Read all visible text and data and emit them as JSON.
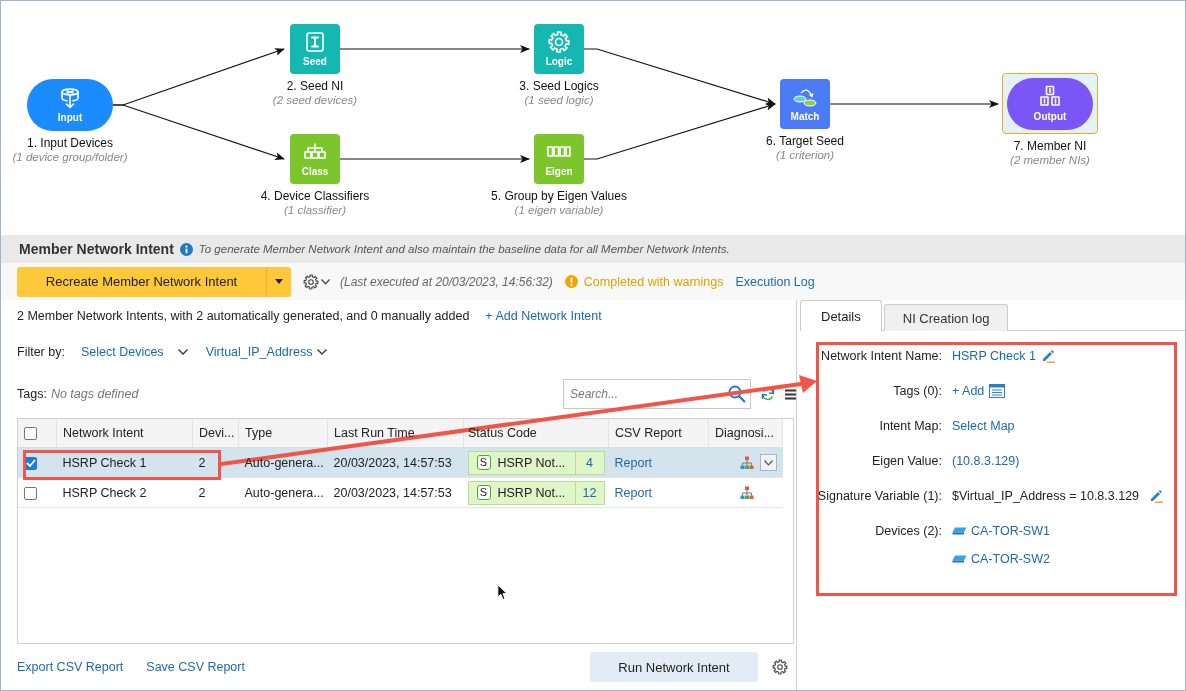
{
  "diagram": {
    "nodes": [
      {
        "kind": "input",
        "tile_label": "Input",
        "title": "1. Input Devices",
        "subtitle": "(1 device group/folder)",
        "color": "#1a8cff",
        "selected": false
      },
      {
        "kind": "seed",
        "tile_label": "Seed",
        "title": "2. Seed NI",
        "subtitle": "(2 seed devices)",
        "color": "#14b8b1",
        "selected": false
      },
      {
        "kind": "logic",
        "tile_label": "Logic",
        "title": "3. Seed Logics",
        "subtitle": "(1 seed logic)",
        "color": "#14b8b1",
        "selected": false
      },
      {
        "kind": "class",
        "tile_label": "Class",
        "title": "4. Device Classifiers",
        "subtitle": "(1 classifier)",
        "color": "#7cc52c",
        "selected": false
      },
      {
        "kind": "eigen",
        "tile_label": "Eigen",
        "title": "5. Group by Eigen Values",
        "subtitle": "(1 eigen variable)",
        "color": "#7cc52c",
        "selected": false
      },
      {
        "kind": "match",
        "tile_label": "Match",
        "title": "6. Target Seed",
        "subtitle": "(1 criterion)",
        "color": "#4b7bf7",
        "selected": false
      },
      {
        "kind": "output",
        "tile_label": "Output",
        "title": "7. Member NI",
        "subtitle": "(2 member NIs)",
        "color": "#7c55f6",
        "selected": true
      }
    ]
  },
  "header": {
    "title": "Member Network Intent",
    "description": "To generate Member Network Intent and also maintain the baseline data for all Member Network Intents."
  },
  "toolbar": {
    "primary_button": "Recreate Member Network Intent",
    "last_executed": "(Last executed at 20/03/2023, 14:56:32)",
    "status": "Completed with warnings",
    "log_link": "Execution Log"
  },
  "summary": {
    "text": "2 Member Network Intents, with 2 automatically generated, and 0 manually added",
    "add_link": "+ Add Network Intent"
  },
  "filter": {
    "label": "Filter by:",
    "options": [
      "Select Devices",
      "Virtual_IP_Address"
    ]
  },
  "tags": {
    "label": "Tags:",
    "value": "No tags defined"
  },
  "search": {
    "placeholder": "Search..."
  },
  "table": {
    "header_checked": false,
    "columns": [
      "Network Intent",
      "Devi...",
      "Type",
      "Last Run Time",
      "Status Code",
      "CSV Report",
      "Diagnosi..."
    ],
    "rows": [
      {
        "selected": true,
        "checked": true,
        "name": "HSRP Check 1",
        "devices": "2",
        "type": "Auto-genera...",
        "last_run": "20/03/2023, 14:57:53",
        "status_badge": "S",
        "status": "HSRP Not...",
        "status_count": "4",
        "report": "Report",
        "menu_button": true
      },
      {
        "selected": false,
        "checked": false,
        "name": "HSRP Check 2",
        "devices": "2",
        "type": "Auto-genera...",
        "last_run": "20/03/2023, 14:57:53",
        "status_badge": "S",
        "status": "HSRP Not...",
        "status_count": "12",
        "report": "Report",
        "menu_button": false
      }
    ]
  },
  "footer": {
    "links": [
      "Export CSV Report",
      "Save CSV Report"
    ],
    "button": "Run Network Intent"
  },
  "details": {
    "tabs": [
      {
        "label": "Details",
        "selected": true
      },
      {
        "label": "NI Creation log",
        "selected": false
      }
    ],
    "fields": [
      {
        "kind": "name",
        "label": "Network Intent Name:",
        "value": "HSRP Check 1"
      },
      {
        "kind": "tags",
        "label": "Tags (0):",
        "value": "+ Add"
      },
      {
        "kind": "link",
        "label": "Intent Map:",
        "value": "Select Map"
      },
      {
        "kind": "link",
        "label": "Eigen Value:",
        "value": "(10.8.3.129)"
      },
      {
        "kind": "variable",
        "label": "Signature Variable (1):",
        "value": "$Virtual_IP_Address = 10.8.3.129"
      },
      {
        "kind": "devices",
        "label": "Devices (2):",
        "devices": [
          "CA-TOR-SW1",
          "CA-TOR-SW2"
        ]
      }
    ]
  },
  "annotations": [
    {
      "kind": "highlight_box"
    },
    {
      "kind": "arrow"
    },
    {
      "kind": "highlight_box"
    },
    {
      "kind": "cursor"
    }
  ]
}
